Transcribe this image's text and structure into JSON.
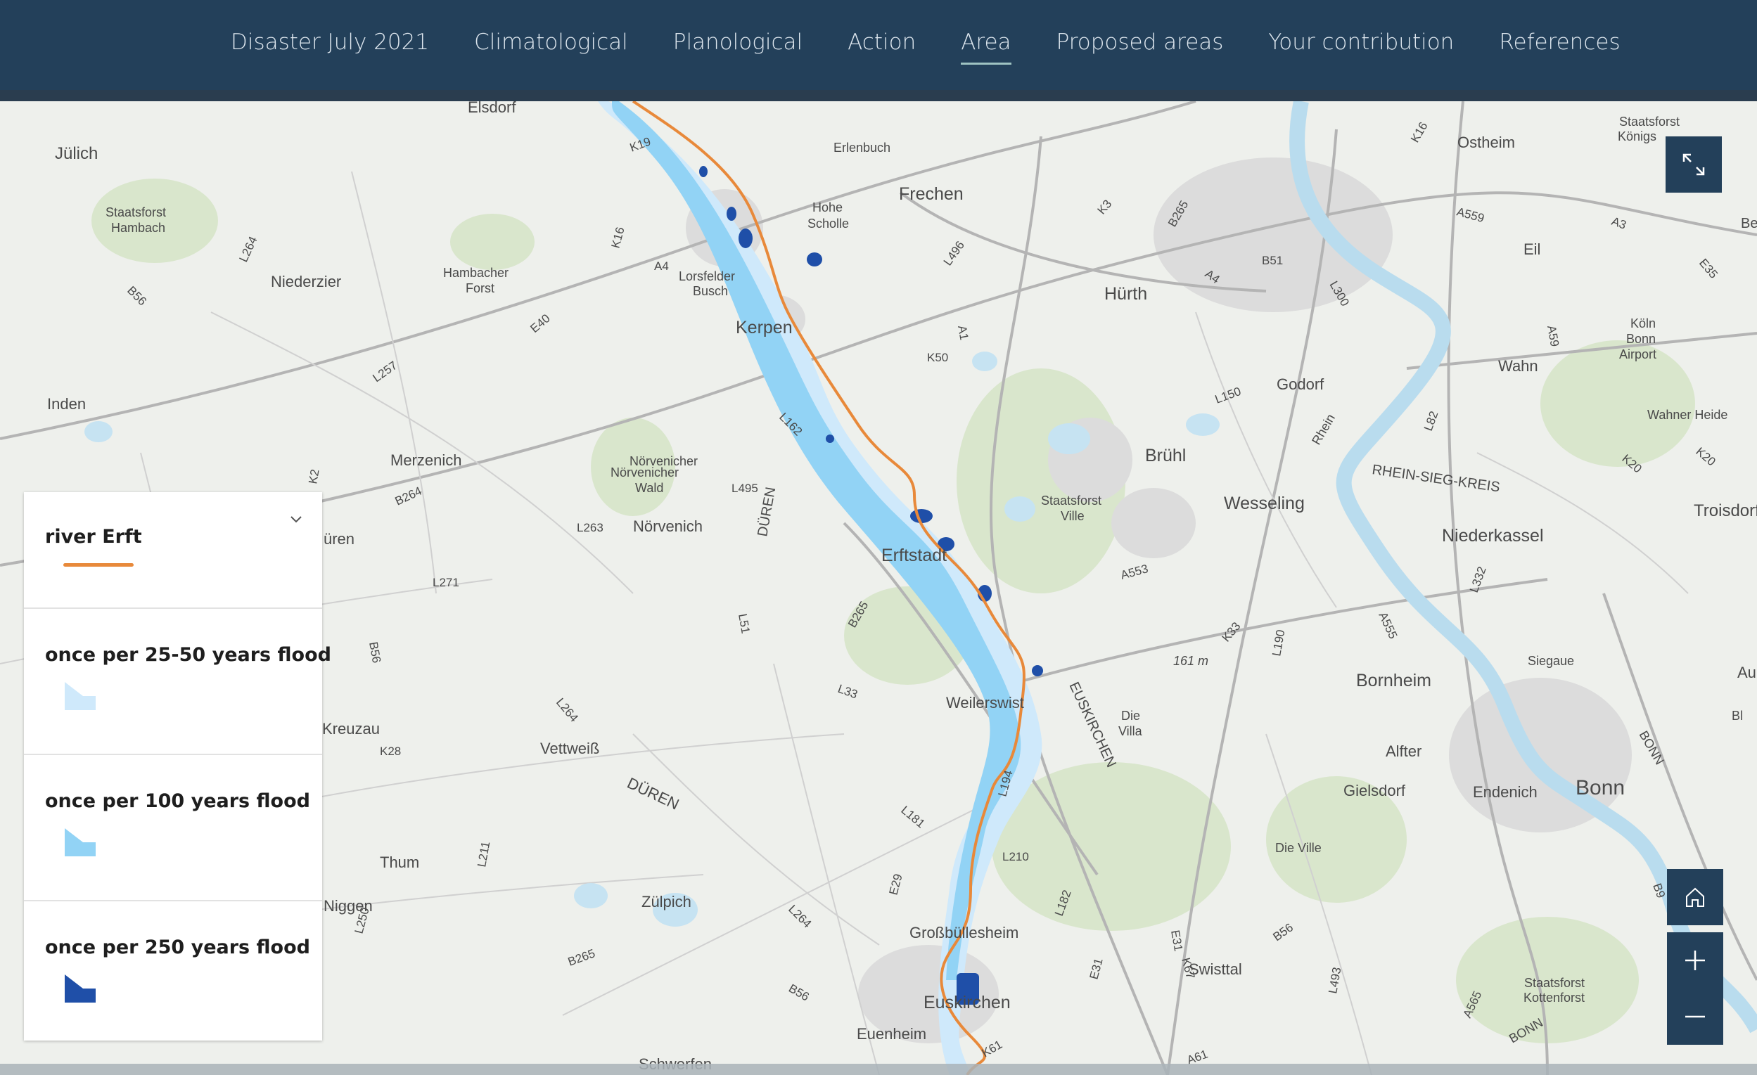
{
  "nav": {
    "items": [
      {
        "label": "Disaster July 2021"
      },
      {
        "label": "Climatological"
      },
      {
        "label": "Planological"
      },
      {
        "label": "Action"
      },
      {
        "label": "Area",
        "active": true
      },
      {
        "label": "Proposed areas"
      },
      {
        "label": "Your contribution"
      },
      {
        "label": "References"
      }
    ]
  },
  "map": {
    "places": {
      "elsdorf": "Elsdorf",
      "julich": "Jülich",
      "staatsforst_hambach": "Staatsforst",
      "hambach": "Hambach",
      "niederzier": "Niederzier",
      "hambacher_forst": "Hambacher",
      "forst": "Forst",
      "erlenbuch": "Erlenbuch",
      "frechen": "Frechen",
      "hohe": "Hohe",
      "scholle": "Scholle",
      "lorsfelder": "Lorsfelder",
      "busch": "Busch",
      "kerpen": "Kerpen",
      "hurth": "Hürth",
      "ostheim": "Ostheim",
      "staatsforst_konigsforst": "Staatsforst",
      "konigs": "Königs",
      "eil": "Eil",
      "koln_bonn": "Köln",
      "bonn_word": "Bonn",
      "airport": "Airport",
      "wahn": "Wahn",
      "wahner_heide": "Wahner Heide",
      "godorf": "Godorf",
      "inden": "Inden",
      "merzenich": "Merzenich",
      "norvenicher": "Nörvenicher",
      "norvenicher2": "Nörvenicher",
      "wald": "Wald",
      "norvenich": "Nörvenich",
      "duren": "Düren",
      "bruhl": "Brühl",
      "wesseling": "Wesseling",
      "troisdorf": "Troisdorf",
      "staatsforst_ville": "Staatsforst",
      "ville": "Ville",
      "erftstadt": "Erftstadt",
      "niederkassel": "Niederkassel",
      "rhein_kreis": "RHEIN-SIEG-KREIS",
      "rhein": "Rhein",
      "kreuzau": "Kreuzau",
      "vettweiss": "Vettweiß",
      "duren_kreis": "DÜREN",
      "duren_kreis2": "DÜREN",
      "weilerswist": "Weilerswist",
      "euskirchen_kreis": "EUSKIRCHEN",
      "die_villa": "Die",
      "die_villa2": "Villa",
      "bornheim": "Bornheim",
      "alfter": "Alfter",
      "gielsdorf": "Gielsdorf",
      "endenich": "Endenich",
      "bonn": "Bonn",
      "siegaue": "Siegaue",
      "thum": "Thum",
      "zulpich": "Zülpich",
      "die_ville": "Die Ville",
      "grosbullesheim": "Großbüllesheim",
      "swisttal": "Swisttal",
      "staatsforst_kottenforst": "Staatsforst",
      "kottenforst": "Kottenforst",
      "euskirchen": "Euskirchen",
      "euenheim": "Euenheim",
      "schwerfen": "Schwerfen",
      "elevation": "161 m",
      "niggen": "Niggen",
      "uren": "üren",
      "bonn_kreis": "BONN",
      "bonn_kreis2": "BONN",
      "bergheim": "Berg",
      "au": "Au",
      "bl": "Bl"
    },
    "roads": [
      "K19",
      "K16",
      "A4",
      "L264",
      "B56",
      "E40",
      "L257",
      "L495",
      "K2",
      "B264",
      "L263",
      "L271",
      "B56",
      "K28",
      "L264",
      "L33",
      "B265",
      "L51",
      "L162",
      "K50",
      "A1",
      "L496",
      "K3",
      "B265",
      "A4",
      "B51",
      "L300",
      "A559",
      "A3",
      "E35",
      "A59",
      "L150",
      "L82",
      "K20",
      "A553",
      "K33",
      "L190",
      "A555",
      "L332",
      "L181",
      "L210",
      "L194",
      "L182",
      "E29",
      "L264",
      "B56",
      "E31",
      "K67",
      "B56",
      "L493",
      "A565",
      "B9",
      "B265",
      "L250",
      "L211",
      "K16",
      "K61",
      "E31",
      "K20",
      "A61"
    ]
  },
  "legend": {
    "items": [
      {
        "label": "river Erft",
        "color": "#e8893a",
        "kind": "line"
      },
      {
        "label": "once per 25-50 years flood",
        "color": "#cfe9fb",
        "kind": "polygon"
      },
      {
        "label": "once per 100 years flood",
        "color": "#92d3f5",
        "kind": "polygon"
      },
      {
        "label": "once per 250 years flood",
        "color": "#1f4fa8",
        "kind": "polygon"
      }
    ]
  },
  "colors": {
    "nav_bg": "#23405a",
    "river_erft": "#e8893a",
    "flood_25_50": "#cfe9fb",
    "flood_100": "#92d3f5",
    "flood_250": "#1f4fa8",
    "rhine": "#b9dcee"
  },
  "icons": [
    "expand-icon",
    "home-icon",
    "zoom-in-icon",
    "zoom-out-icon",
    "chevron-down-icon"
  ]
}
